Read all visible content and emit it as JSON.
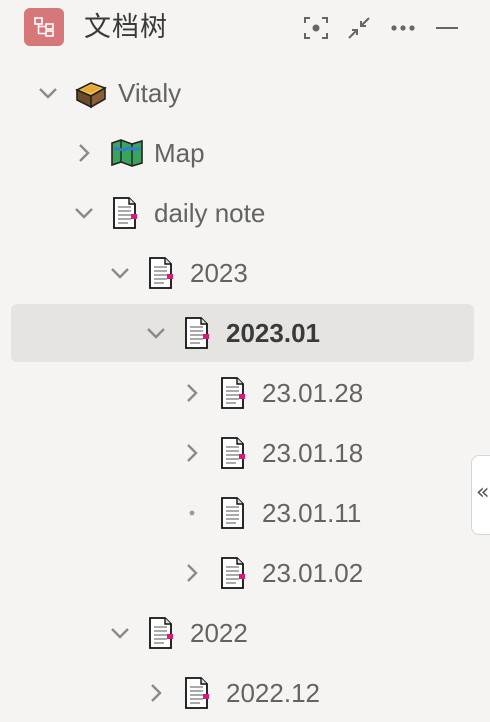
{
  "header": {
    "title": "文档树"
  },
  "tree": [
    {
      "label": "Vitaly",
      "icon": "box-icon",
      "toggle": "chevron-down"
    },
    {
      "label": "Map",
      "icon": "map-icon",
      "toggle": "chevron-right"
    },
    {
      "label": "daily note",
      "icon": "doc-icon",
      "toggle": "chevron-down"
    },
    {
      "label": "2023",
      "icon": "doc-icon",
      "toggle": "chevron-down"
    },
    {
      "label": "2023.01",
      "icon": "doc-icon",
      "toggle": "chevron-down",
      "selected": true
    },
    {
      "label": "23.01.28",
      "icon": "doc-icon",
      "toggle": "chevron-right"
    },
    {
      "label": "23.01.18",
      "icon": "doc-icon",
      "toggle": "chevron-right"
    },
    {
      "label": "23.01.11",
      "icon": "doc-icon",
      "toggle": "dot"
    },
    {
      "label": "23.01.02",
      "icon": "doc-icon",
      "toggle": "chevron-right"
    },
    {
      "label": "2022",
      "icon": "doc-icon",
      "toggle": "chevron-down"
    },
    {
      "label": "2022.12",
      "icon": "doc-icon",
      "toggle": "chevron-right"
    }
  ],
  "collapse_tab": {
    "glyph": "«"
  },
  "colors": {
    "accent": "#d6777a",
    "selected_bg": "#e6e4e1",
    "bookmark": "#e0157d"
  }
}
